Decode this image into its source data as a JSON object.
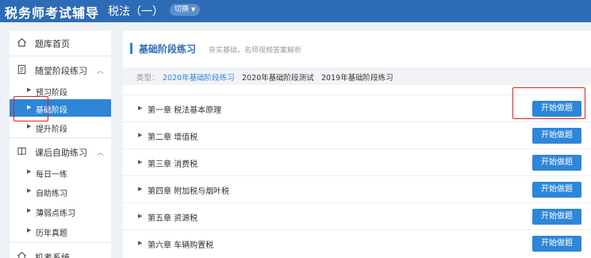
{
  "header": {
    "brand": "税务师考试辅导",
    "subject": "税法（一）",
    "switch_label": "切换"
  },
  "sidebar": {
    "home": "题库首页",
    "section1": {
      "title": "随堂阶段练习",
      "items": [
        "预习阶段",
        "基础阶段",
        "提升阶段"
      ],
      "active_index": 1
    },
    "section2": {
      "title": "课后自助练习",
      "items": [
        "每日一练",
        "自助练习",
        "薄弱点练习",
        "历年真题"
      ]
    },
    "section3": {
      "title": "机考系统"
    }
  },
  "main": {
    "title": "基础阶段练习",
    "subtitle": "夯实基础，名师视频答案解析",
    "filter": {
      "label": "类型：",
      "options": [
        "2020年基础阶段练习",
        "2020年基础阶段测试",
        "2019年基础阶段练习"
      ],
      "active_index": 0
    },
    "chapters": [
      "第一章 税法基本原理",
      "第二章 增值税",
      "第三章 消费税",
      "第四章 附加税与烟叶税",
      "第五章 资源税",
      "第六章 车辆购置税"
    ],
    "start_label": "开始做题"
  },
  "colors": {
    "header_bg": "#2d6cb5",
    "accent": "#2d86d8",
    "highlight_box": "#e02020"
  }
}
